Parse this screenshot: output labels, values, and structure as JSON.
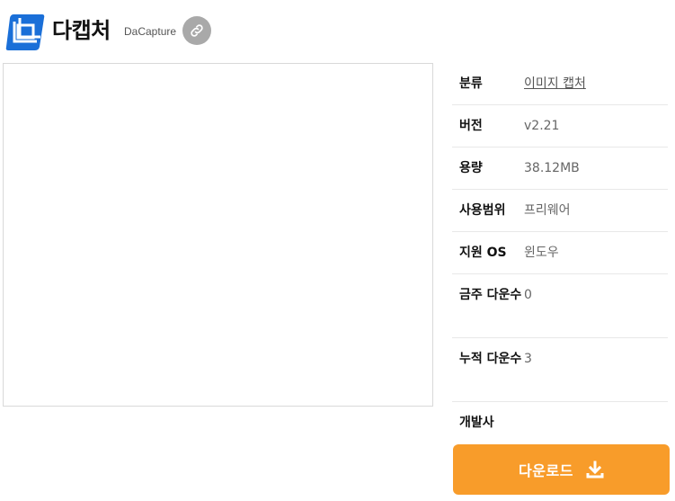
{
  "app": {
    "title": "다캡처",
    "subtitle": "DaCapture",
    "logo_icon": "crop-icon",
    "link_icon": "link-icon"
  },
  "details": [
    {
      "key": "분류",
      "value": "이미지 캡처",
      "link": true
    },
    {
      "key": "버전",
      "value": "v2.21"
    },
    {
      "key": "용량",
      "value": "38.12MB"
    },
    {
      "key": "사용범위",
      "value": "프리웨어"
    },
    {
      "key": "지원 OS",
      "value": "윈도우"
    },
    {
      "key": "금주 다운수",
      "value": "0"
    },
    {
      "key": "누적 다운수",
      "value": "3"
    },
    {
      "key": "개발사",
      "value": ""
    }
  ],
  "download": {
    "label": "다운로드",
    "icon": "download-icon"
  },
  "colors": {
    "accent": "#f89c2a",
    "logo_blue": "#1a6fd8",
    "link_button": "#a9a9a9"
  }
}
